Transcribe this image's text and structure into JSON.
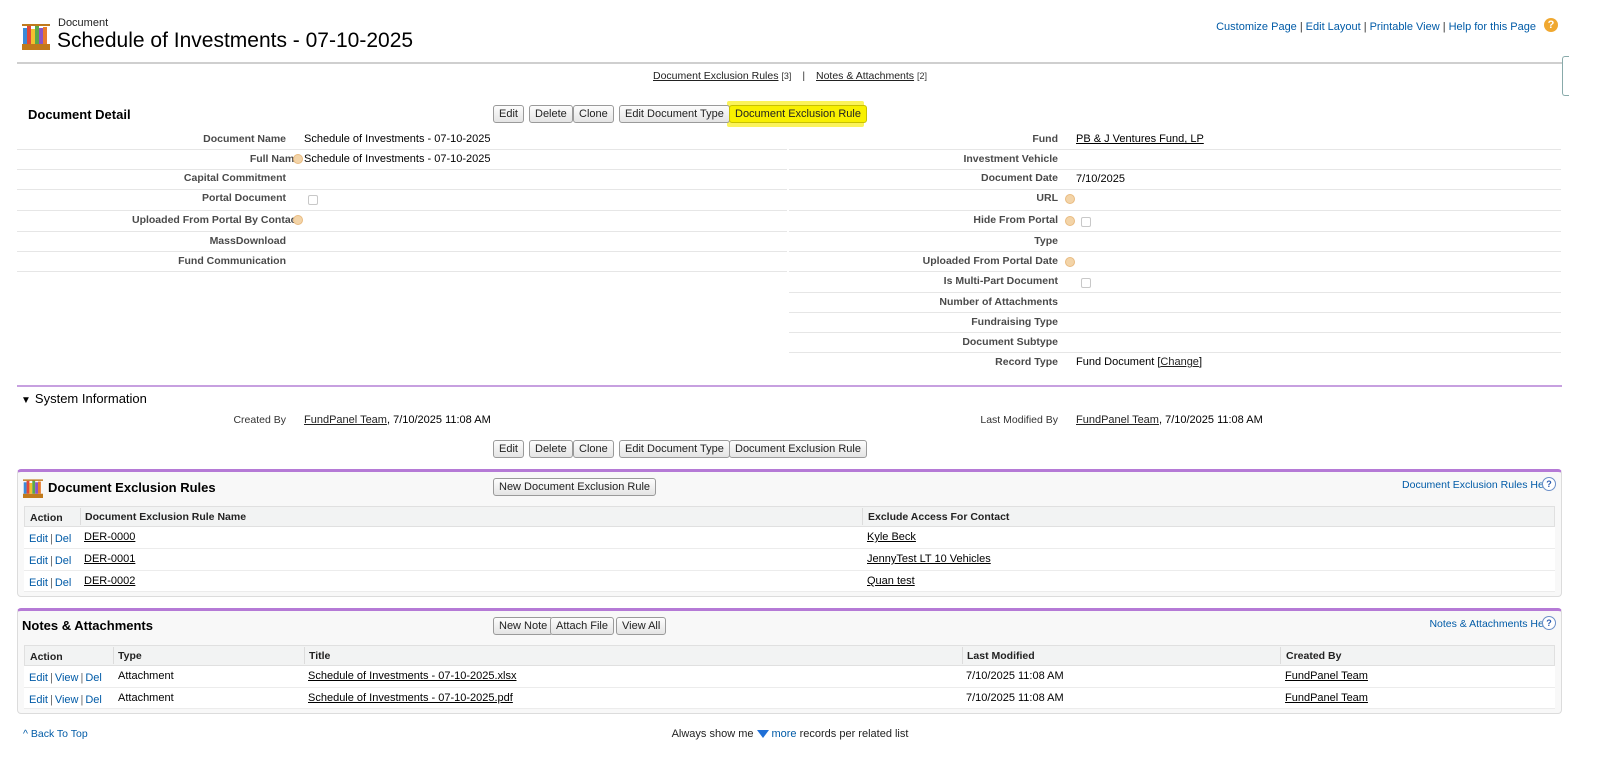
{
  "header": {
    "object_type": "Document",
    "title": "Schedule of Investments - 07-10-2025",
    "links": [
      "Customize Page",
      "Edit Layout",
      "Printable View",
      "Help for this Page"
    ],
    "help_glyph": "?"
  },
  "related_links": [
    {
      "label": "Document Exclusion Rules",
      "count": "[3]"
    },
    {
      "label": "Notes & Attachments",
      "count": "[2]"
    }
  ],
  "related_links_sep": "|",
  "detail": {
    "title": "Document Detail",
    "buttons": [
      "Edit",
      "Delete",
      "Clone",
      "Edit Document Type",
      "Document Exclusion Rule"
    ],
    "left_fields": [
      {
        "label": "Document Name",
        "value": "Schedule of Investments - 07-10-2025"
      },
      {
        "label": "Full Name",
        "value": "Schedule of Investments - 07-10-2025"
      },
      {
        "label": "Capital Commitment",
        "value": ""
      },
      {
        "label": "Portal Document",
        "value": ""
      },
      {
        "label": "Uploaded From Portal By Contact",
        "value": ""
      },
      {
        "label": "MassDownload",
        "value": ""
      },
      {
        "label": "Fund Communication",
        "value": ""
      }
    ],
    "right_fields": [
      {
        "label": "Fund",
        "value": "PB & J Ventures Fund, LP"
      },
      {
        "label": "Investment Vehicle",
        "value": ""
      },
      {
        "label": "Document Date",
        "value": "7/10/2025"
      },
      {
        "label": "URL",
        "value": ""
      },
      {
        "label": "Hide From Portal",
        "value": ""
      },
      {
        "label": "Type",
        "value": ""
      },
      {
        "label": "Uploaded From Portal Date",
        "value": ""
      },
      {
        "label": "Is Multi-Part Document",
        "value": ""
      },
      {
        "label": "Number of Attachments",
        "value": ""
      },
      {
        "label": "Fundraising Type",
        "value": ""
      },
      {
        "label": "Document Subtype",
        "value": ""
      },
      {
        "label": "Record Type",
        "value": "Fund Document",
        "change_open": "[",
        "change_link": "Change",
        "change_close": "]"
      }
    ]
  },
  "system_info": {
    "title": "System Information",
    "created_by_label": "Created By",
    "created_by_user": "FundPanel Team",
    "created_by_date": ", 7/10/2025 11:08 AM",
    "modified_by_label": "Last Modified By",
    "modified_by_user": "FundPanel Team",
    "modified_by_date": ", 7/10/2025 11:08 AM"
  },
  "exclusion_rules": {
    "title": "Document Exclusion Rules",
    "new_button": "New Document Exclusion Rule",
    "help": "Document Exclusion Rules Help",
    "columns": [
      "Action",
      "Document Exclusion Rule Name",
      "Exclude Access For Contact"
    ],
    "rows": [
      {
        "edit": "Edit",
        "del": "Del",
        "name": "DER-0000",
        "contact": "Kyle Beck"
      },
      {
        "edit": "Edit",
        "del": "Del",
        "name": "DER-0001",
        "contact": "JennyTest LT 10 Vehicles"
      },
      {
        "edit": "Edit",
        "del": "Del",
        "name": "DER-0002",
        "contact": "Quan test"
      }
    ]
  },
  "notes": {
    "title": "Notes & Attachments",
    "buttons": [
      "New Note",
      "Attach File",
      "View All"
    ],
    "help": "Notes & Attachments Help",
    "columns": [
      "Action",
      "Type",
      "Title",
      "Last Modified",
      "Created By"
    ],
    "rows": [
      {
        "edit": "Edit",
        "view": "View",
        "del": "Del",
        "type": "Attachment",
        "title": "Schedule of Investments - 07-10-2025.xlsx",
        "modified": "7/10/2025 11:08 AM",
        "created_by": "FundPanel Team"
      },
      {
        "edit": "Edit",
        "view": "View",
        "del": "Del",
        "type": "Attachment",
        "title": "Schedule of Investments - 07-10-2025.pdf",
        "modified": "7/10/2025 11:08 AM",
        "created_by": "FundPanel Team"
      }
    ]
  },
  "footer": {
    "back_to_top": "Back To Top",
    "back_glyph": "^",
    "always_show_prefix": "Always show me",
    "more_link": "more",
    "always_show_suffix": "records per related list"
  },
  "colors": {
    "link": "#015ba7",
    "highlight": "#f8f000",
    "section_accent": "#b57ad6"
  },
  "icons": [
    "document-stack-icon",
    "help-icon",
    "info-icon",
    "triangle-down-icon"
  ]
}
